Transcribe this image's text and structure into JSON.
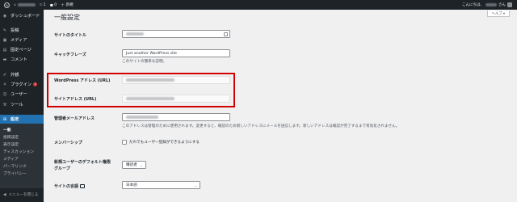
{
  "adminbar": {
    "wp_logo": "W",
    "home_icon": "⌂",
    "site_name": "",
    "updates_icon": "↻",
    "updates_count": "1",
    "comments_icon": "💬",
    "comments_count": "0",
    "new_icon": "+",
    "new_label": "新規",
    "greeting": "こんにちは、",
    "greeting_suffix": "さん"
  },
  "sidebar": {
    "items": [
      {
        "icon": "◉",
        "label": "ダッシュボード"
      },
      {
        "icon": "✎",
        "label": "投稿"
      },
      {
        "icon": "▣",
        "label": "メディア"
      },
      {
        "icon": "▤",
        "label": "固定ページ"
      },
      {
        "icon": "▬",
        "label": "コメント"
      },
      {
        "icon": "✐",
        "label": "外観"
      },
      {
        "icon": "⚘",
        "label": "プラグイン",
        "badge": "1"
      },
      {
        "icon": "☺",
        "label": "ユーザー"
      },
      {
        "icon": "⚒",
        "label": "ツール"
      },
      {
        "icon": "⊞",
        "label": "設定"
      }
    ],
    "submenu": [
      "一般",
      "投稿設定",
      "表示設定",
      "ディスカッション",
      "メディア",
      "パーマリンク",
      "プライバシー"
    ],
    "collapse_icon": "◀",
    "collapse_label": "メニューを閉じる"
  },
  "help_tab": "ヘルプ ▾",
  "page_title": "一般設定",
  "form": {
    "site_title_label": "サイトのタイトル",
    "tagline_label": "キャッチフレーズ",
    "tagline_value": "Just another WordPress site",
    "tagline_desc": "このサイトの簡単な説明。",
    "wp_address_label": "WordPress アドレス (URL)",
    "site_address_label": "サイトアドレス (URL)",
    "admin_email_label": "管理者メールアドレス",
    "admin_email_desc": "このアドレスは管理のために使用されます。変更すると、確認のため新しいアドレスにメールを送信します。新しいアドレスは確認が完了するまで有効化されません。",
    "membership_label": "メンバーシップ",
    "membership_check": "だれでもユーザー登録ができるようにする",
    "default_role_label_1": "新規ユーザーのデフォルト権限",
    "default_role_label_2": "グループ",
    "default_role_value": "購読者",
    "site_language_label": "サイトの言語",
    "site_language_value": "日本語"
  },
  "colors": {
    "admin_bar": "#1d2327",
    "accent": "#2271b1",
    "highlight": "#d10000",
    "badge": "#d63638"
  }
}
